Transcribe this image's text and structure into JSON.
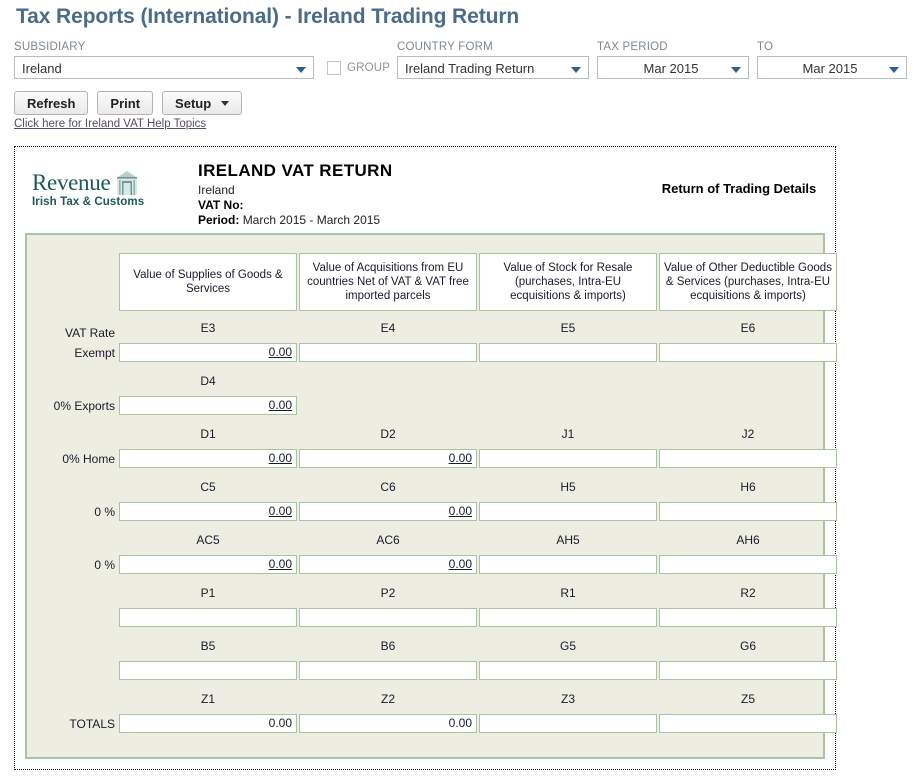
{
  "page_title": "Tax Reports (International) - Ireland Trading Return",
  "filters": {
    "subsidiary": {
      "label": "SUBSIDIARY",
      "value": "Ireland"
    },
    "group": {
      "label": "GROUP",
      "checked": false
    },
    "country_form": {
      "label": "COUNTRY FORM",
      "value": "Ireland Trading Return"
    },
    "tax_period": {
      "label": "TAX PERIOD",
      "value": "Mar 2015"
    },
    "to": {
      "label": "TO",
      "value": "Mar 2015"
    }
  },
  "toolbar": {
    "refresh_label": "Refresh",
    "print_label": "Print",
    "setup_label": "Setup"
  },
  "help_link": "Click here for Ireland VAT Help Topics",
  "report": {
    "logo_main": "Revenue",
    "logo_sub": "Irish Tax & Customs",
    "title": "IRELAND VAT RETURN",
    "country": "Ireland",
    "vat_no_label": "VAT No:",
    "vat_no_value": "",
    "period_label": "Period:",
    "period_value": "March 2015 - March 2015",
    "right_title": "Return of Trading Details",
    "columns": [
      "Value of Supplies of Goods & Services",
      "Value of Acquisitions from EU countries Net of VAT & VAT free imported parcels",
      "Value of Stock for Resale (purchases, Intra-EU ecquisitions & imports)",
      "Value of Other Deductible Goods & Services (purchases, Intra-EU ecquisitions & imports)"
    ],
    "rows": [
      {
        "label_top": "VAT Rate",
        "label_bottom": "Exempt",
        "cells": [
          {
            "code": "E3",
            "value": "0.00",
            "link": true
          },
          {
            "code": "E4",
            "value": "",
            "link": false
          },
          {
            "code": "E5",
            "value": "",
            "link": false
          },
          {
            "code": "E6",
            "value": "",
            "link": false
          }
        ]
      },
      {
        "label_top": "",
        "label_bottom": "0% Exports",
        "cells": [
          {
            "code": "D4",
            "value": "0.00",
            "link": true
          }
        ]
      },
      {
        "label_top": "",
        "label_bottom": "0% Home",
        "cells": [
          {
            "code": "D1",
            "value": "0.00",
            "link": true
          },
          {
            "code": "D2",
            "value": "0.00",
            "link": true
          },
          {
            "code": "J1",
            "value": "",
            "link": false
          },
          {
            "code": "J2",
            "value": "",
            "link": false
          }
        ]
      },
      {
        "label_top": "",
        "label_bottom": "0 %",
        "cells": [
          {
            "code": "C5",
            "value": "0.00",
            "link": true
          },
          {
            "code": "C6",
            "value": "0.00",
            "link": true
          },
          {
            "code": "H5",
            "value": "",
            "link": false
          },
          {
            "code": "H6",
            "value": "",
            "link": false
          }
        ]
      },
      {
        "label_top": "",
        "label_bottom": "0 %",
        "cells": [
          {
            "code": "AC5",
            "value": "0.00",
            "link": true
          },
          {
            "code": "AC6",
            "value": "0.00",
            "link": true
          },
          {
            "code": "AH5",
            "value": "",
            "link": false
          },
          {
            "code": "AH6",
            "value": "",
            "link": false
          }
        ]
      },
      {
        "label_top": "",
        "label_bottom": "",
        "cells": [
          {
            "code": "P1",
            "value": "",
            "link": false
          },
          {
            "code": "P2",
            "value": "",
            "link": false
          },
          {
            "code": "R1",
            "value": "",
            "link": false
          },
          {
            "code": "R2",
            "value": "",
            "link": false
          }
        ]
      },
      {
        "label_top": "",
        "label_bottom": "",
        "cells": [
          {
            "code": "B5",
            "value": "",
            "link": false
          },
          {
            "code": "B6",
            "value": "",
            "link": false
          },
          {
            "code": "G5",
            "value": "",
            "link": false
          },
          {
            "code": "G6",
            "value": "",
            "link": false
          }
        ]
      },
      {
        "label_top": "",
        "label_bottom": "TOTALS",
        "cells": [
          {
            "code": "Z1",
            "value": "0.00",
            "link": false
          },
          {
            "code": "Z2",
            "value": "0.00",
            "link": false
          },
          {
            "code": "Z3",
            "value": "",
            "link": false
          },
          {
            "code": "Z5",
            "value": "",
            "link": false
          }
        ]
      }
    ]
  },
  "colors": {
    "title": "#4a6b8a",
    "panel_bg": "#edeee1",
    "panel_border": "#a9c4a2",
    "logo_green": "#1d5a57"
  }
}
